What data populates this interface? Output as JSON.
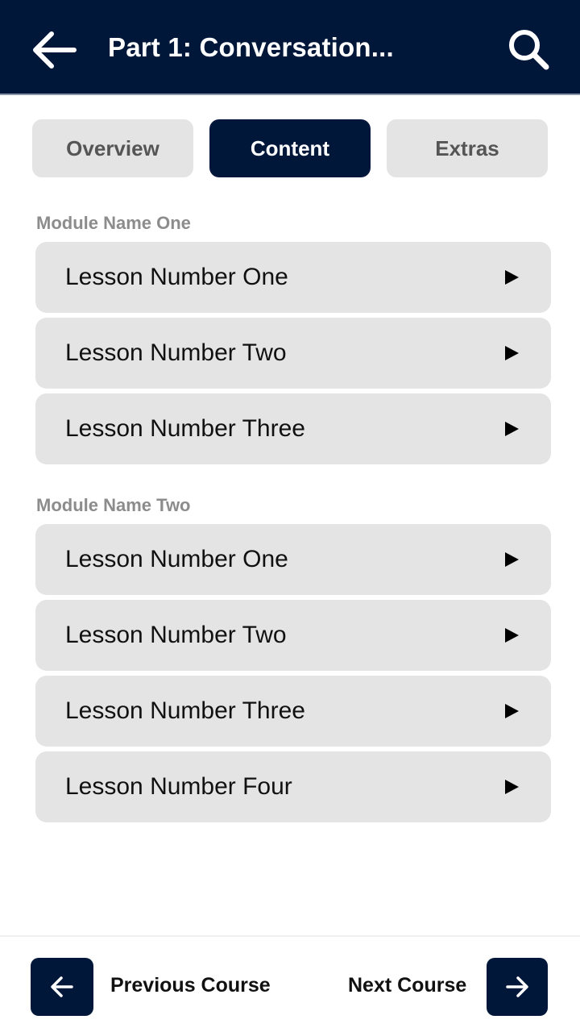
{
  "header": {
    "title": "Part 1: Conversation...",
    "back_icon": "arrow-left-icon",
    "search_icon": "search-icon",
    "background": "#01173a"
  },
  "tabs": [
    {
      "label": "Overview",
      "active": false
    },
    {
      "label": "Content",
      "active": true
    },
    {
      "label": "Extras",
      "active": false
    }
  ],
  "modules": [
    {
      "name": "Module Name One",
      "lessons": [
        "Lesson Number One",
        "Lesson Number Two",
        "Lesson Number Three"
      ]
    },
    {
      "name": "Module Name Two",
      "lessons": [
        "Lesson Number One",
        "Lesson Number Two",
        "Lesson Number Three",
        "Lesson Number Four"
      ]
    }
  ],
  "footer": {
    "previous_label": "Previous Course",
    "next_label": "Next Course",
    "previous_icon": "arrow-left-icon",
    "next_icon": "arrow-right-icon"
  },
  "colors": {
    "accent": "#01173a",
    "item_background": "#e4e4e4",
    "module_label": "#8c8c8c"
  }
}
